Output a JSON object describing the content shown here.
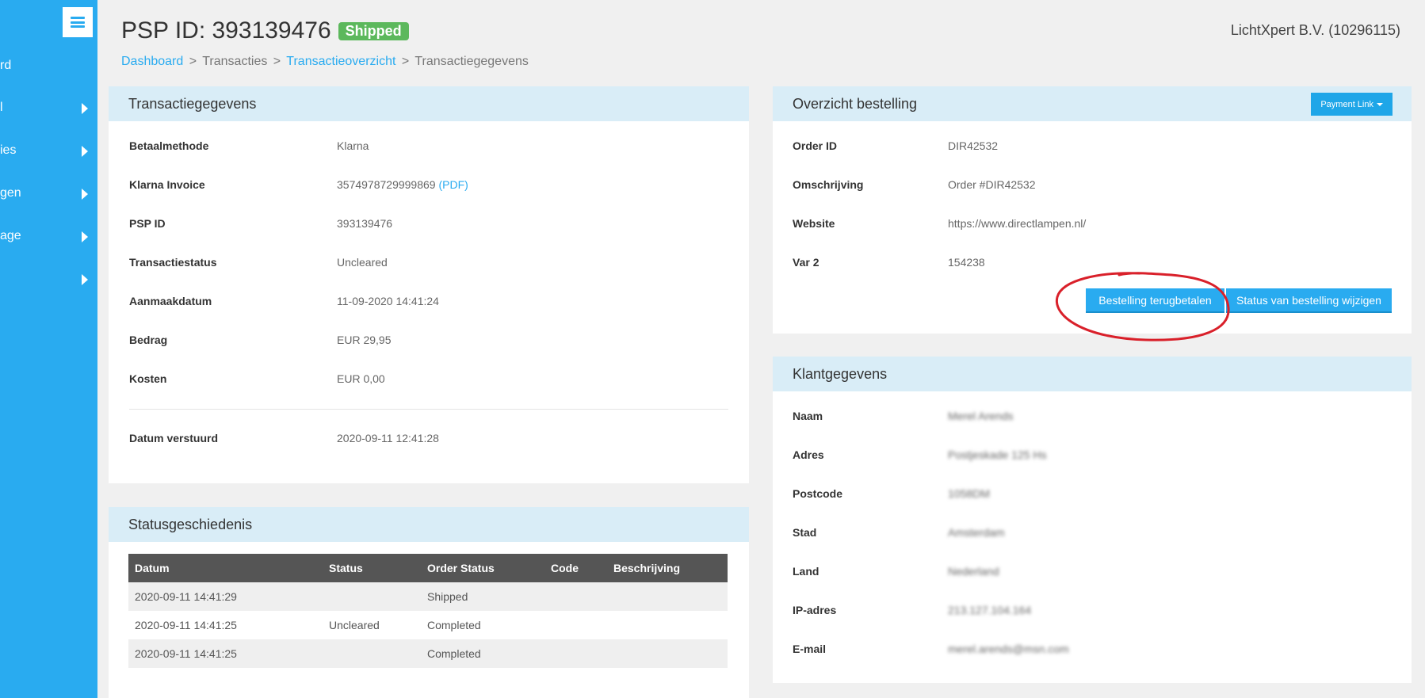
{
  "sidebar": {
    "items": [
      {
        "label": "rd",
        "has_arrow": false
      },
      {
        "label": "l",
        "has_arrow": true
      },
      {
        "label": "ies",
        "has_arrow": true
      },
      {
        "label": "gen",
        "has_arrow": true
      },
      {
        "label": "age",
        "has_arrow": true
      },
      {
        "label": "",
        "has_arrow": true
      }
    ]
  },
  "header": {
    "title": "PSP ID: 393139476",
    "status_badge": "Shipped",
    "merchant": "LichtXpert B.V. (10296115)"
  },
  "breadcrumb": {
    "items": [
      "Dashboard",
      "Transacties",
      "Transactieoverzicht",
      "Transactiegegevens"
    ],
    "separator": ">"
  },
  "transaction": {
    "title": "Transactiegegevens",
    "rows": [
      {
        "key": "Betaalmethode",
        "value": "Klarna"
      },
      {
        "key": "Klarna Invoice",
        "value": "3574978729999869",
        "link": "(PDF)"
      },
      {
        "key": "PSP ID",
        "value": "393139476"
      },
      {
        "key": "Transactiestatus",
        "value": "Uncleared"
      },
      {
        "key": "Aanmaakdatum",
        "value": "11-09-2020 14:41:24"
      },
      {
        "key": "Bedrag",
        "value": "EUR 29,95"
      },
      {
        "key": "Kosten",
        "value": "EUR 0,00"
      },
      {
        "key": "Datum verstuurd",
        "value": "2020-09-11 12:41:28"
      }
    ]
  },
  "history": {
    "title": "Statusgeschiedenis",
    "columns": [
      "Datum",
      "Status",
      "Order Status",
      "Code",
      "Beschrijving"
    ],
    "rows": [
      [
        "2020-09-11 14:41:29",
        "",
        "Shipped",
        "",
        ""
      ],
      [
        "2020-09-11 14:41:25",
        "Uncleared",
        "Completed",
        "",
        ""
      ],
      [
        "2020-09-11 14:41:25",
        "",
        "Completed",
        "",
        ""
      ]
    ]
  },
  "order": {
    "title": "Overzicht bestelling",
    "dropdown_label": "Payment Link",
    "rows": [
      {
        "key": "Order ID",
        "value": "DIR42532"
      },
      {
        "key": "Omschrijving",
        "value": "Order #DIR42532"
      },
      {
        "key": "Website",
        "value": "https://www.directlampen.nl/"
      },
      {
        "key": "Var 2",
        "value": "154238"
      }
    ],
    "refund_button": "Bestelling terugbetalen",
    "status_button": "Status van bestelling wijzigen"
  },
  "customer": {
    "title": "Klantgegevens",
    "rows": [
      {
        "key": "Naam",
        "value": "Merel Arends"
      },
      {
        "key": "Adres",
        "value": "Postjeskade 125 Hs"
      },
      {
        "key": "Postcode",
        "value": "1058DM"
      },
      {
        "key": "Stad",
        "value": "Amsterdam"
      },
      {
        "key": "Land",
        "value": "Nederland"
      },
      {
        "key": "IP-adres",
        "value": "213.127.104.164"
      },
      {
        "key": "E-mail",
        "value": "merel.arends@msn.com"
      }
    ]
  },
  "colors": {
    "sidebar": "#29abf0",
    "panel_header": "#d9edf7",
    "badge": "#5cb85c",
    "annotation": "#d9202a"
  }
}
